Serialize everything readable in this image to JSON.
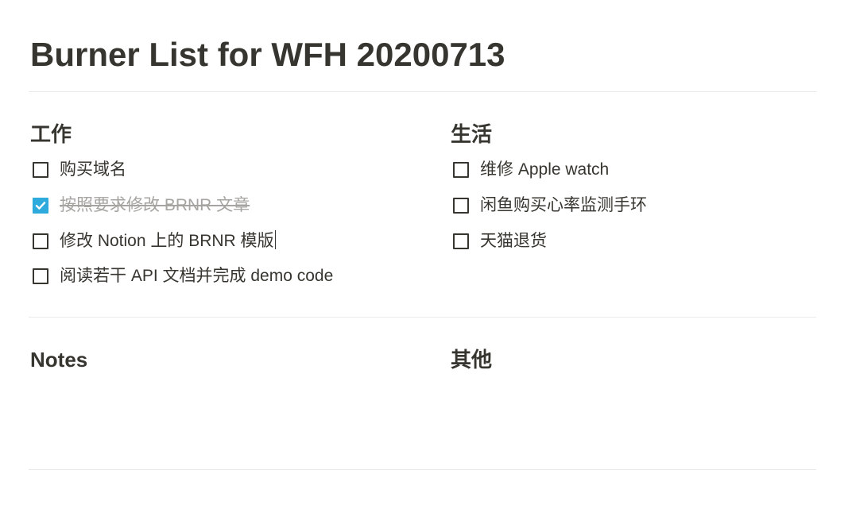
{
  "page": {
    "title": "Burner List for WFH 20200713"
  },
  "sections": {
    "work": {
      "heading": "工作",
      "items": [
        {
          "text": "购买域名",
          "checked": false
        },
        {
          "text": "按照要求修改 BRNR 文章",
          "checked": true
        },
        {
          "text": "修改 Notion 上的 BRNR 模版",
          "checked": false
        },
        {
          "text": "阅读若干 API 文档并完成 demo code",
          "checked": false
        }
      ]
    },
    "life": {
      "heading": "生活",
      "items": [
        {
          "text": "维修 Apple watch",
          "checked": false
        },
        {
          "text": "闲鱼购买心率监测手环",
          "checked": false
        },
        {
          "text": "天猫退货",
          "checked": false
        }
      ]
    },
    "notes": {
      "heading": "Notes"
    },
    "other": {
      "heading": "其他"
    }
  },
  "colors": {
    "text": "#37352f",
    "checked_fill": "#2eaadc",
    "done_text": "#a5a4a0",
    "divider": "#e9e9e7"
  }
}
